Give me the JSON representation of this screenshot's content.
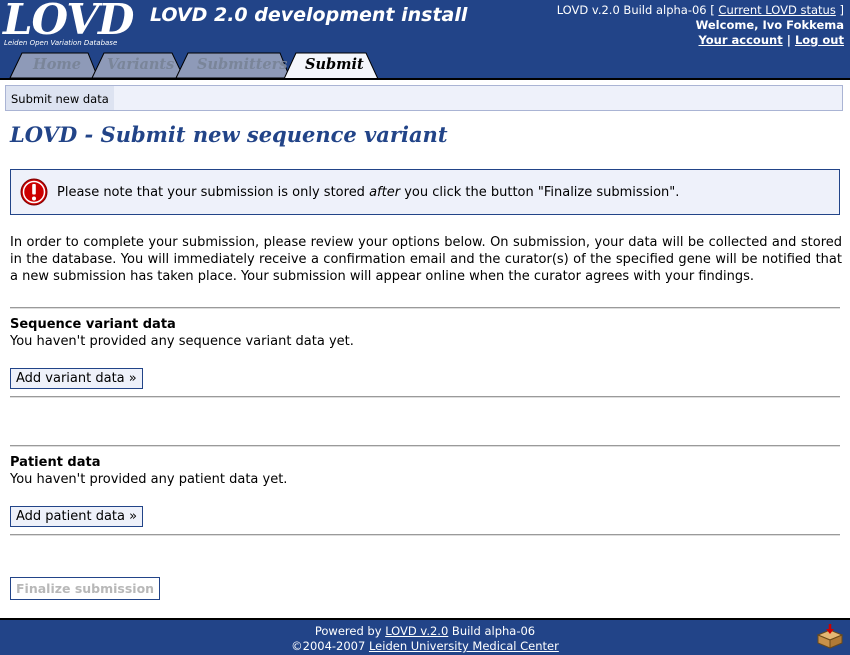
{
  "header": {
    "logo_text": "LOVD",
    "logo_subtext": "Leiden Open Variation Database",
    "site_title": "LOVD 2.0 development install",
    "status_prefix": "LOVD v.2.0 Build alpha-06 [",
    "status_link": "Current LOVD status",
    "status_suffix": "]",
    "welcome": "Welcome, Ivo Fokkema",
    "account_link": "Your account",
    "separator": "|",
    "logout_link": "Log out"
  },
  "tabs": [
    {
      "label": "Home",
      "active": false
    },
    {
      "label": "Variants",
      "active": false
    },
    {
      "label": "Submitters",
      "active": false
    },
    {
      "label": "Submit",
      "active": true
    }
  ],
  "breadcrumb": {
    "item": "Submit new data"
  },
  "page_title": "LOVD - Submit new sequence variant",
  "notice": {
    "before": "Please note that your submission is only stored ",
    "emphasis": "after",
    "after": " you click the button \"Finalize submission\".",
    "icon": "error-exclamation-icon"
  },
  "intro": "In order to complete your submission, please review your options below. On submission, your data will be collected and stored in the database. You will immediately receive a confirmation email and the curator(s) of the specified gene will be notified that a new submission has taken place. Your submission will appear online when the curator agrees with your findings.",
  "sections": {
    "variant": {
      "title": "Sequence variant data",
      "text": "You haven't provided any sequence variant data yet.",
      "button": "Add variant data »"
    },
    "patient": {
      "title": "Patient data",
      "text": "You haven't provided any patient data yet.",
      "button": "Add patient data »"
    }
  },
  "finalize_button": "Finalize submission",
  "footer": {
    "powered_prefix": "Powered by ",
    "powered_link": "LOVD v.2.0",
    "powered_suffix": " Build alpha-06",
    "copyright_prefix": "©2004-2007 ",
    "copyright_link": "Leiden University Medical Center",
    "icon": "package-icon"
  },
  "colors": {
    "brand": "#224488",
    "light_bg": "#eef1fa",
    "error_red": "#cc0000"
  }
}
